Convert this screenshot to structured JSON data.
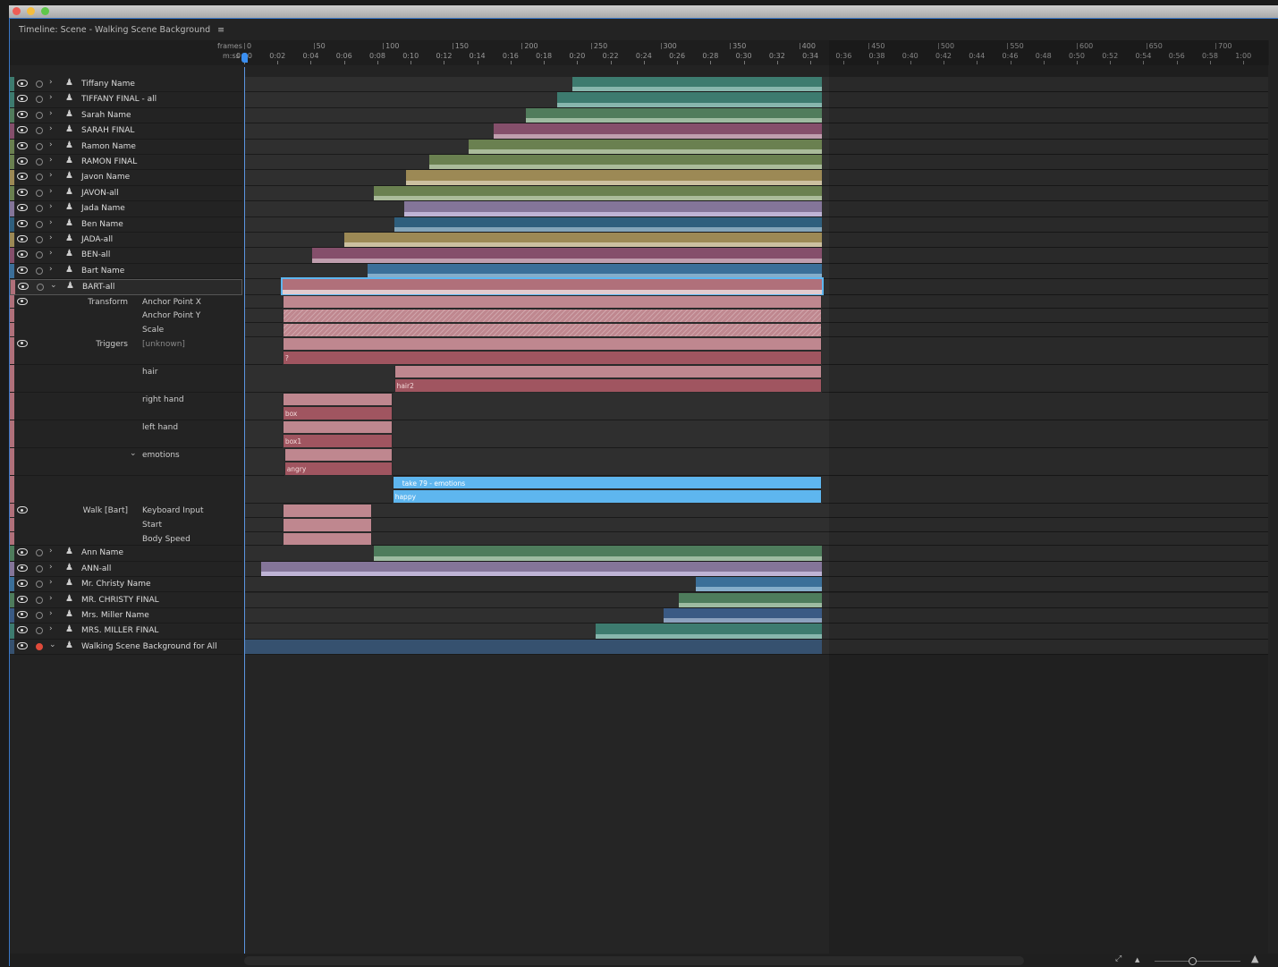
{
  "window": {
    "title": "Timeline: Scene - Walking Scene Background",
    "menu_icon": "hamburger-icon"
  },
  "ruler": {
    "frames_label": "frames",
    "time_label": "m:ss",
    "fps": 12,
    "frame_ticks": [
      "0",
      "50",
      "100",
      "150",
      "200",
      "250",
      "300",
      "350",
      "400",
      "450",
      "500",
      "550",
      "600",
      "650",
      "700"
    ],
    "time_ticks": [
      "0:00",
      "0:02",
      "0:04",
      "0:06",
      "0:08",
      "0:10",
      "0:12",
      "0:14",
      "0:16",
      "0:18",
      "0:20",
      "0:22",
      "0:24",
      "0:26",
      "0:28",
      "0:30",
      "0:32",
      "0:34",
      "0:36",
      "0:38",
      "0:40",
      "0:42",
      "0:44",
      "0:46",
      "0:48",
      "0:50",
      "0:52",
      "0:54",
      "0:56",
      "0:58",
      "1:00"
    ],
    "playhead": "0:00",
    "scene_end_seconds": 34.9
  },
  "layers": [
    {
      "name": "Tiffany Name",
      "color": "#3d7b6f",
      "light": "#8fbdb4",
      "start": 19.7
    },
    {
      "name": "TIFFANY FINAL - all",
      "color": "#3d7b6f",
      "light": "#8fbdb4",
      "start": 18.8
    },
    {
      "name": "Sarah Name",
      "color": "#517c5c",
      "light": "#a6c2a8",
      "start": 16.9
    },
    {
      "name": "SARAH FINAL",
      "color": "#854f6b",
      "light": "#c6a6b6",
      "start": 15.0
    },
    {
      "name": "Ramon Name",
      "color": "#6a8050",
      "light": "#b1c1a2",
      "start": 13.5
    },
    {
      "name": "RAMON FINAL",
      "color": "#6a8050",
      "light": "#b1c1a2",
      "start": 11.1
    },
    {
      "name": "Javon Name",
      "color": "#9c8955",
      "light": "#d2c7a8",
      "start": 9.7
    },
    {
      "name": "JAVON-all",
      "color": "#6a8050",
      "light": "#b1c1a2",
      "start": 7.8
    },
    {
      "name": "Jada Name",
      "color": "#847599",
      "light": "#c4badb",
      "start": 9.6
    },
    {
      "name": "Ben Name",
      "color": "#2f5f7d",
      "light": "#8eadc0",
      "start": 9.0
    },
    {
      "name": "JADA-all",
      "color": "#9c8955",
      "light": "#d2c7a8",
      "start": 6.0
    },
    {
      "name": "BEN-all",
      "color": "#854f6b",
      "light": "#c6a6b6",
      "start": 4.1
    },
    {
      "name": "Bart Name",
      "color": "#3b6f99",
      "light": "#8eb4cf",
      "start": 7.4
    },
    {
      "name": "BART-all",
      "color": "#b0707a",
      "light": "#e8d6d8",
      "start": 2.3,
      "expanded": true,
      "selected": true
    }
  ],
  "bart_params": [
    {
      "group": "Transform",
      "param": "Anchor Point X",
      "eye": true
    },
    {
      "group": "",
      "param": "Anchor Point Y"
    },
    {
      "group": "",
      "param": "Scale"
    },
    {
      "group": "Triggers",
      "param": "[unknown]",
      "eye": true,
      "take": "?"
    },
    {
      "group": "",
      "param": "hair",
      "take": "hair2"
    },
    {
      "group": "",
      "param": "right hand",
      "take": "box"
    },
    {
      "group": "",
      "param": "left hand",
      "take": "box1"
    },
    {
      "group": "",
      "param": "emotions",
      "take": "angry",
      "chevron": true
    },
    {
      "group": "",
      "param": "",
      "take_title": "take 79 - emotions",
      "take": "happy"
    },
    {
      "group": "Walk [Bart]",
      "param": "Keyboard Input",
      "eye": true
    },
    {
      "group": "",
      "param": "Start"
    },
    {
      "group": "",
      "param": "Body Speed"
    }
  ],
  "layers_after": [
    {
      "name": "Ann Name",
      "color": "#4e7c5c",
      "light": "#a6c2a8",
      "start": 7.8
    },
    {
      "name": "ANN-all",
      "color": "#847599",
      "light": "#c4badb",
      "start": 1.0
    },
    {
      "name": "Mr. Christy Name",
      "color": "#3b6f99",
      "light": "#8eb4cf",
      "start": 27.1
    },
    {
      "name": "MR. CHRISTY FINAL",
      "color": "#4e7c5c",
      "light": "#a6c2a8",
      "start": 26.1
    },
    {
      "name": "Mrs. Miller Name",
      "color": "#3a5a84",
      "light": "#95a9c3",
      "start": 25.2
    },
    {
      "name": "MRS. MILLER FINAL",
      "color": "#3d7b6f",
      "light": "#8fbdb4",
      "start": 21.1
    },
    {
      "name": "Walking Scene Background for All",
      "color": "#36516f",
      "light": "#36516f",
      "start": 0,
      "recording": true,
      "expanded": true
    }
  ],
  "colors": {
    "accent": "#3a8ef0",
    "take_blue": "#5eb6ef",
    "trigger_light": "#bf878f",
    "trigger_dark": "#a05560"
  }
}
